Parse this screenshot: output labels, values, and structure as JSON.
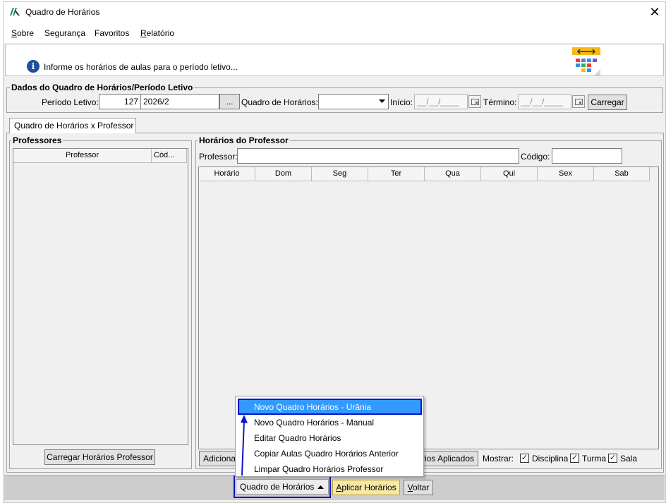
{
  "window": {
    "title": "Quadro de Horários",
    "close_symbol": "✕"
  },
  "menu": [
    "Sobre",
    "Segurança",
    "Favoritos",
    "Relatório"
  ],
  "info": {
    "text": "Informe os horários de aulas para o período letivo...",
    "icon_letter": "i"
  },
  "dados": {
    "group_title": "Dados do Quadro de Horários/Período Letivo",
    "periodo_label": "Período Letivo:",
    "periodo_code": "127",
    "periodo_name": "2026/2",
    "ellipsis_button": "...",
    "quadro_label": "Quadro de Horários:",
    "quadro_value": "",
    "inicio_label": "Início:",
    "inicio_value": "__/__/____",
    "termino_label": "Término:",
    "termino_value": "__/__/____",
    "carregar_button": "Carregar"
  },
  "tab": {
    "label": "Quadro de Horários x Professor"
  },
  "professores": {
    "group_title": "Professores",
    "columns": [
      "Professor",
      "Cód..."
    ],
    "carregar_button": "Carregar Horários Professor"
  },
  "horarios": {
    "group_title": "Horários do Professor",
    "professor_label": "Professor:",
    "professor_value": "",
    "codigo_label": "Código:",
    "codigo_value": "",
    "columns": [
      "Horário",
      "Dom",
      "Seg",
      "Ter",
      "Qua",
      "Qui",
      "Sex",
      "Sab"
    ],
    "adicionar_button": "Adiciona",
    "aplicados_button": "rios Aplicados",
    "mostrar_label": "Mostrar:",
    "checks": [
      {
        "label": "Disciplina",
        "checked": "✓"
      },
      {
        "label": "Turma",
        "checked": "✓"
      },
      {
        "label": "Sala",
        "checked": "✓"
      }
    ]
  },
  "popup_menu": {
    "items": [
      "Novo Quadro Horários - Urânia",
      "Novo Quadro Horários - Manual",
      "Editar Quadro Horários",
      "Copiar Aulas Quadro Horários Anterior",
      "Limpar Quadro Horários Professor"
    ],
    "highlight_color": "#3399ff",
    "annotation_color": "#0b16c8"
  },
  "bottom": {
    "quadro_button": "Quadro de Horários",
    "aplicar_button": "Aplicar Horários",
    "voltar_button": "Voltar"
  }
}
